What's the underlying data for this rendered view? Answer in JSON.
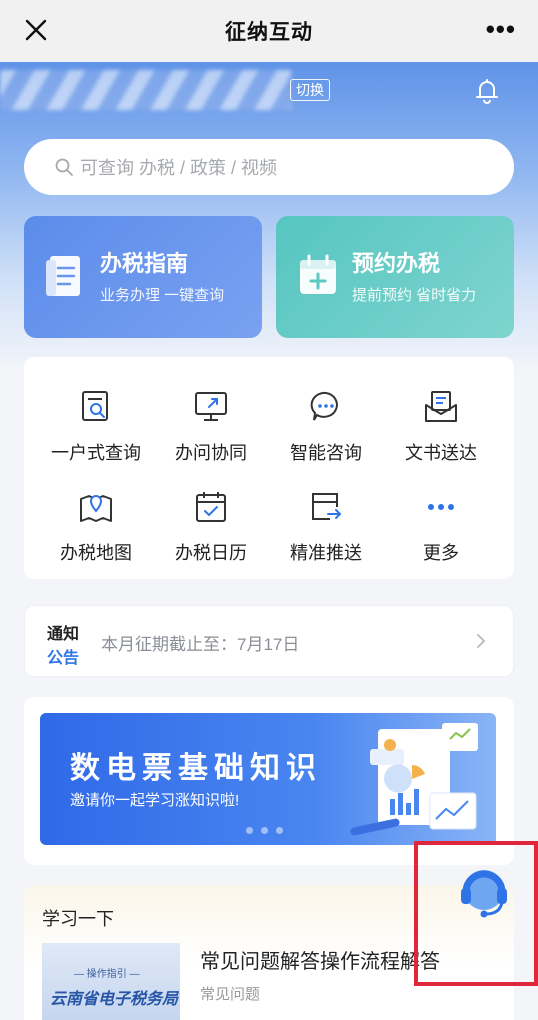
{
  "titlebar": {
    "title": "征纳互动",
    "more": "•••"
  },
  "location": {
    "switch_label": "切换"
  },
  "search": {
    "placeholder": "可查询 办税 / 政策 / 视频"
  },
  "cards": {
    "guide": {
      "title": "办税指南",
      "subtitle": "业务办理 一键查询"
    },
    "appointment": {
      "title": "预约办税",
      "subtitle": "提前预约 省时省力"
    }
  },
  "services": [
    {
      "label": "一户式查询",
      "icon": "document-search-icon"
    },
    {
      "label": "办问协同",
      "icon": "screen-share-icon"
    },
    {
      "label": "智能咨询",
      "icon": "chat-bubble-icon"
    },
    {
      "label": "文书送达",
      "icon": "mail-document-icon"
    },
    {
      "label": "办税地图",
      "icon": "map-pin-icon"
    },
    {
      "label": "办税日历",
      "icon": "calendar-check-icon"
    },
    {
      "label": "精准推送",
      "icon": "card-arrow-icon"
    },
    {
      "label": "更多",
      "icon": "more-dots-icon"
    }
  ],
  "notice": {
    "tag_line1": "通知",
    "tag_line2": "公告",
    "text": "本月征期截止至：7月17日"
  },
  "banner": {
    "title": "数电票基础知识",
    "subtitle": "邀请你一起学习涨知识啦!"
  },
  "learn": {
    "section_title": "学习一下",
    "thumb_line1": "— 操作指引 —",
    "thumb_line2": "云南省电子税务局",
    "article_title": "常见问题解答操作流程解答",
    "article_tag": "常见问题"
  },
  "colors": {
    "accent_blue": "#2f74e6",
    "guide_card": "#5b8cea",
    "appoint_card": "#56c5c0",
    "highlight_red": "#e0263a"
  }
}
